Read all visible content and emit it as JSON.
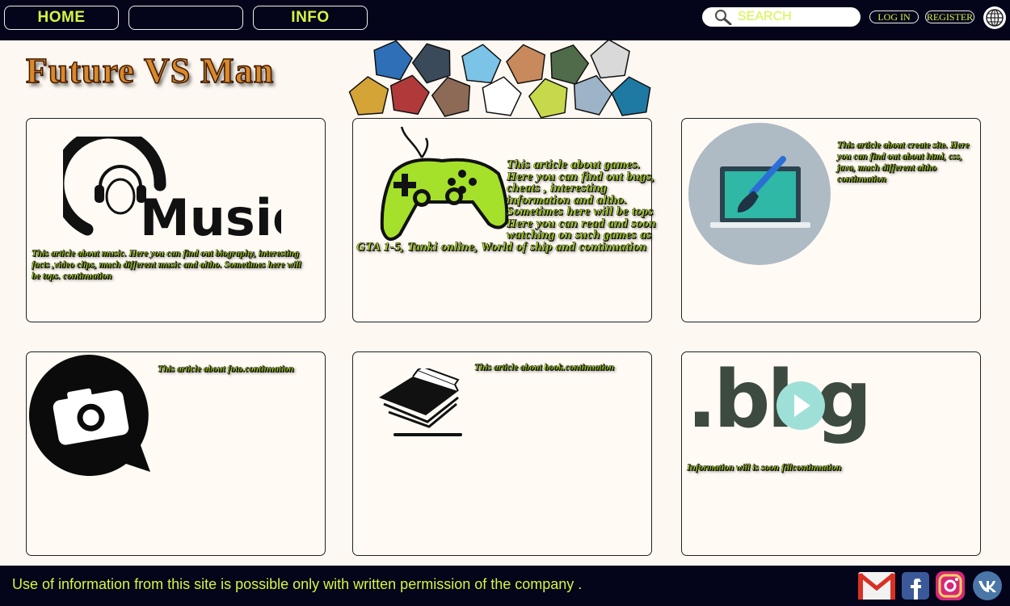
{
  "nav": {
    "home_label": "HOME",
    "blank_label": "",
    "info_label": "INFO"
  },
  "search": {
    "placeholder": "SEARCH",
    "value": ""
  },
  "auth": {
    "login_label": "LOG IN",
    "register_label": "REGISTER"
  },
  "logo": {
    "text": "Future VS Man"
  },
  "cards": [
    {
      "id": "music",
      "text": "This article about music. Here you can find out biography, interesting facts ,video clips, much different music and altho. Sometimes here will be tops. continuation"
    },
    {
      "id": "games",
      "text": "This article about games. Here you can find out bugs, cheats , interesting information and altho. Sometimes here will be tops Here you can read and soon watching on such games as GTA 1-5, Tanki online, World of ship and continuation"
    },
    {
      "id": "site",
      "text": "This article about create site. Here you can find out about html, css, java, much different altho continuation"
    },
    {
      "id": "foto",
      "text": "This article about foto.continuation"
    },
    {
      "id": "book",
      "text": "This article about book.continuation"
    },
    {
      "id": "blog",
      "text": "Information will is soon fillcontinuation"
    }
  ],
  "icon_text": {
    "music_word": "Music",
    "blog_word": ".bl g"
  },
  "footer": {
    "text": "Use of information from this site is possible only with written permission of the company ."
  },
  "social": [
    "gmail-icon",
    "facebook-icon",
    "instagram-icon",
    "vk-icon"
  ],
  "colors": {
    "bar": "#04041a",
    "accent": "#d6f542",
    "page": "#fdf8f1",
    "article_text": "#b5e61d"
  }
}
